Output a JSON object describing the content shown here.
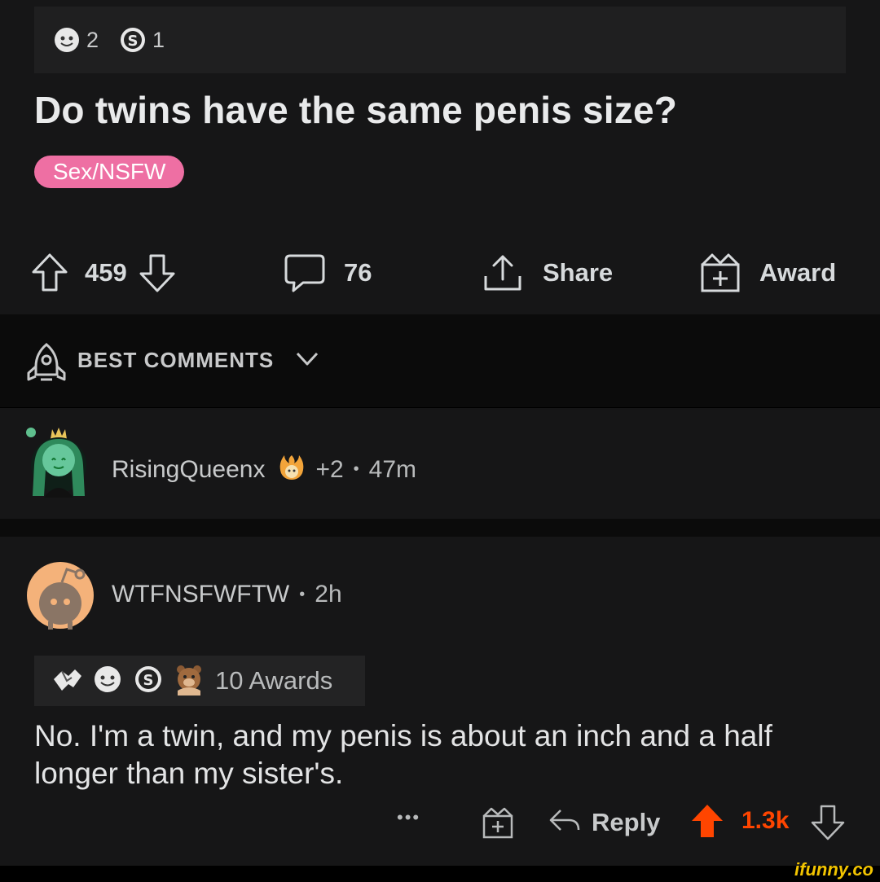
{
  "post": {
    "award_counts": [
      {
        "icon": "wholesome-award-icon",
        "count": "2"
      },
      {
        "icon": "silver-award-icon",
        "count": "1"
      }
    ],
    "title": "Do twins have the same penis size?",
    "flair": "Sex/NSFW",
    "flair_color": "#ee6fa3",
    "votes": "459",
    "comments": "76",
    "share_label": "Share",
    "award_label": "Award"
  },
  "sort": {
    "label": "BEST COMMENTS"
  },
  "comment1": {
    "username": "RisingQueenx",
    "awards_plus": "+2",
    "separator": "•",
    "time": "47m"
  },
  "comment2": {
    "username": "WTFNSFWFTW",
    "separator": "•",
    "time": "2h",
    "awards_text": "10 Awards",
    "body": "No. I'm a twin, and my penis is about an inch and a half longer than my sister's.",
    "more": "•••",
    "reply_label": "Reply",
    "score": "1.3k",
    "score_color": "#ff4500"
  },
  "watermark": "ifunny.co"
}
